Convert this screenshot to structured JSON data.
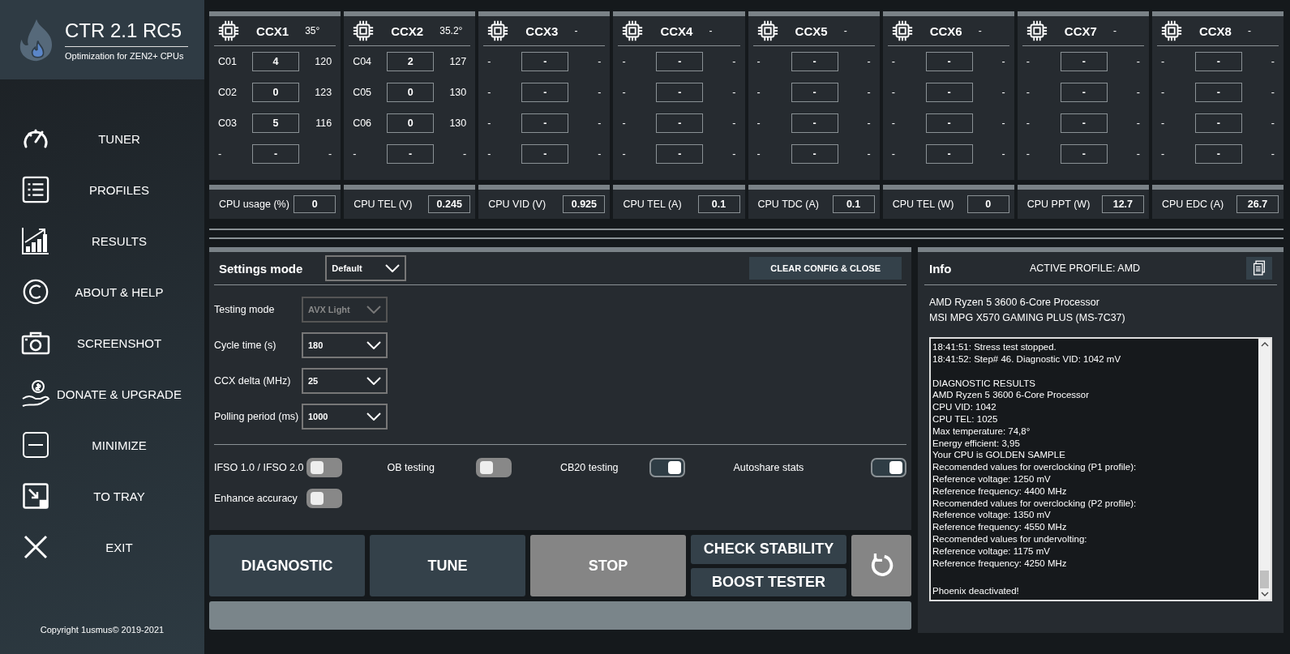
{
  "app": {
    "title": "CTR 2.1 RC5",
    "subtitle": "Optimization for ZEN2+ CPUs",
    "copyright": "Copyright 1usmus© 2019-2021"
  },
  "sidebar": [
    {
      "label": "TUNER",
      "kind": "gauge"
    },
    {
      "label": "PROFILES",
      "kind": "list"
    },
    {
      "label": "RESULTS",
      "kind": "chart"
    },
    {
      "label": "ABOUT & HELP",
      "kind": "copyright"
    },
    {
      "label": "SCREENSHOT",
      "kind": "camera"
    },
    {
      "label": "DONATE & UPGRADE",
      "kind": "donate"
    },
    {
      "label": "MINIMIZE",
      "kind": "minimize"
    },
    {
      "label": "TO TRAY",
      "kind": "tray"
    },
    {
      "label": "EXIT",
      "kind": "exit"
    }
  ],
  "ccx": [
    {
      "name": "CCX1",
      "temp": "35°",
      "cores": [
        {
          "label": "C01",
          "value": "4",
          "freq": "120"
        },
        {
          "label": "C02",
          "value": "0",
          "freq": "123"
        },
        {
          "label": "C03",
          "value": "5",
          "freq": "116"
        },
        {
          "label": "-",
          "value": "-",
          "freq": "-"
        }
      ]
    },
    {
      "name": "CCX2",
      "temp": "35.2°",
      "cores": [
        {
          "label": "C04",
          "value": "2",
          "freq": "127"
        },
        {
          "label": "C05",
          "value": "0",
          "freq": "130"
        },
        {
          "label": "C06",
          "value": "0",
          "freq": "130"
        },
        {
          "label": "-",
          "value": "-",
          "freq": "-"
        }
      ]
    },
    {
      "name": "CCX3",
      "temp": "-",
      "cores": [
        {
          "label": "-",
          "value": "-",
          "freq": "-"
        },
        {
          "label": "-",
          "value": "-",
          "freq": "-"
        },
        {
          "label": "-",
          "value": "-",
          "freq": "-"
        },
        {
          "label": "-",
          "value": "-",
          "freq": "-"
        }
      ]
    },
    {
      "name": "CCX4",
      "temp": "-",
      "cores": [
        {
          "label": "-",
          "value": "-",
          "freq": "-"
        },
        {
          "label": "-",
          "value": "-",
          "freq": "-"
        },
        {
          "label": "-",
          "value": "-",
          "freq": "-"
        },
        {
          "label": "-",
          "value": "-",
          "freq": "-"
        }
      ]
    },
    {
      "name": "CCX5",
      "temp": "-",
      "cores": [
        {
          "label": "-",
          "value": "-",
          "freq": "-"
        },
        {
          "label": "-",
          "value": "-",
          "freq": "-"
        },
        {
          "label": "-",
          "value": "-",
          "freq": "-"
        },
        {
          "label": "-",
          "value": "-",
          "freq": "-"
        }
      ]
    },
    {
      "name": "CCX6",
      "temp": "-",
      "cores": [
        {
          "label": "-",
          "value": "-",
          "freq": "-"
        },
        {
          "label": "-",
          "value": "-",
          "freq": "-"
        },
        {
          "label": "-",
          "value": "-",
          "freq": "-"
        },
        {
          "label": "-",
          "value": "-",
          "freq": "-"
        }
      ]
    },
    {
      "name": "CCX7",
      "temp": "-",
      "cores": [
        {
          "label": "-",
          "value": "-",
          "freq": "-"
        },
        {
          "label": "-",
          "value": "-",
          "freq": "-"
        },
        {
          "label": "-",
          "value": "-",
          "freq": "-"
        },
        {
          "label": "-",
          "value": "-",
          "freq": "-"
        }
      ]
    },
    {
      "name": "CCX8",
      "temp": "-",
      "cores": [
        {
          "label": "-",
          "value": "-",
          "freq": "-"
        },
        {
          "label": "-",
          "value": "-",
          "freq": "-"
        },
        {
          "label": "-",
          "value": "-",
          "freq": "-"
        },
        {
          "label": "-",
          "value": "-",
          "freq": "-"
        }
      ]
    }
  ],
  "metrics": [
    {
      "label": "CPU usage (%)",
      "value": "0"
    },
    {
      "label": "CPU TEL (V)",
      "value": "0.245"
    },
    {
      "label": "CPU VID (V)",
      "value": "0.925"
    },
    {
      "label": "CPU TEL (A)",
      "value": "0.1"
    },
    {
      "label": "CPU TDC (A)",
      "value": "0.1"
    },
    {
      "label": "CPU TEL (W)",
      "value": "0"
    },
    {
      "label": "CPU PPT (W)",
      "value": "12.7"
    },
    {
      "label": "CPU EDC (A)",
      "value": "26.7"
    }
  ],
  "settings": {
    "title": "Settings mode",
    "mode": "Default",
    "clear_button": "CLEAR CONFIG & CLOSE",
    "selects": [
      {
        "label": "Testing mode",
        "value": "AVX Light",
        "disabled": true
      },
      {
        "label": "Cycle time (s)",
        "value": "180",
        "disabled": false
      },
      {
        "label": "CCX delta (MHz)",
        "value": "25",
        "disabled": false
      },
      {
        "label": "Polling period (ms)",
        "value": "1000",
        "disabled": false
      }
    ],
    "toggles": [
      {
        "label": "IFSO 1.0 / IFSO 2.0",
        "on": false
      },
      {
        "label": "OB testing",
        "on": false
      },
      {
        "label": "CB20 testing",
        "on": true
      },
      {
        "label": "Autoshare stats",
        "on": true
      },
      {
        "label": "Enhance accuracy",
        "on": false
      }
    ]
  },
  "actions": [
    {
      "label": "DIAGNOSTIC",
      "disabled": false
    },
    {
      "label": "TUNE",
      "disabled": false
    },
    {
      "label": "STOP",
      "disabled": true
    }
  ],
  "side_actions": [
    "CHECK STABILITY",
    "BOOST TESTER"
  ],
  "reset_button": {
    "disabled": true
  },
  "info": {
    "title": "Info",
    "profile": "ACTIVE PROFILE: AMD",
    "cpu": "AMD Ryzen 5 3600 6-Core Processor",
    "board": "MSI MPG X570 GAMING PLUS (MS-7C37)",
    "log": [
      [
        "18:41:51: Stress test stopped.",
        "18:41:52: Step# 46. Diagnostic VID: 1042 mV"
      ],
      [
        "DIAGNOSTIC RESULTS",
        "AMD Ryzen 5 3600 6-Core Processor",
        "CPU VID: 1042",
        "CPU TEL: 1025",
        "Max temperature: 74,8°",
        "Energy efficient: 3,95",
        "Your CPU is GOLDEN SAMPLE",
        "Recomended values for overclocking (P1 profile):",
        "Reference voltage: 1250 mV",
        "Reference frequency: 4400 MHz",
        "Recomended values for overclocking (P2 profile):",
        "Reference voltage: 1350 mV",
        "Reference frequency: 4550 MHz",
        "Recomended values for undervolting:",
        "Reference voltage: 1175 mV",
        "Reference frequency: 4250 MHz"
      ],
      [
        "Phoenix deactivated!"
      ]
    ]
  }
}
